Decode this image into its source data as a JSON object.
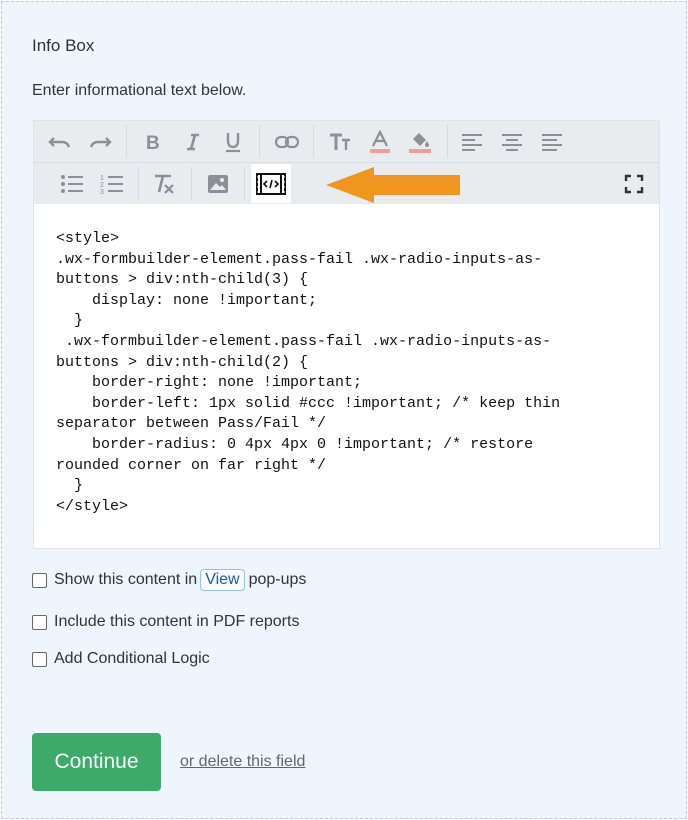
{
  "form": {
    "title": "Info Box",
    "subtitle": "Enter informational text below."
  },
  "editor": {
    "toolbar_row1": [
      "undo-icon",
      "redo-icon",
      "bold-icon",
      "italic-icon",
      "underline-icon",
      "link-icon",
      "font-size-icon",
      "font-color-icon",
      "highlight-icon",
      "align-left-icon",
      "align-center-icon",
      "align-right-icon"
    ],
    "toolbar_row2": [
      "bullet-list-icon",
      "numbered-list-icon",
      "clear-format-icon",
      "image-icon",
      "source-code-icon",
      "fullscreen-icon"
    ],
    "active_tool": "source-code-icon",
    "arrow_color": "#f0951e",
    "code_lines": [
      "<style>",
      ".wx-formbuilder-element.pass-fail .wx-radio-inputs-as-",
      "buttons > div:nth-child(3) {",
      "    display: none !important;",
      "  }",
      " .wx-formbuilder-element.pass-fail .wx-radio-inputs-as-",
      "buttons > div:nth-child(2) {",
      "    border-right: none !important;",
      "    border-left: 1px solid #ccc !important; /* keep thin",
      "separator between Pass/Fail */",
      "    border-radius: 0 4px 4px 0 !important; /* restore",
      "rounded corner on far right */",
      "  }",
      "</style>"
    ]
  },
  "options": {
    "show_prefix": "Show this content in",
    "view_link": "View",
    "show_suffix": "pop-ups",
    "include_pdf": "Include this content in PDF reports",
    "conditional": "Add Conditional Logic"
  },
  "actions": {
    "continue_label": "Continue",
    "delete_label": "or delete this field"
  },
  "colors": {
    "panel_bg": "#eef5fd",
    "continue_bg": "#3daa6a",
    "toolbar_bg": "#e9ecef"
  }
}
